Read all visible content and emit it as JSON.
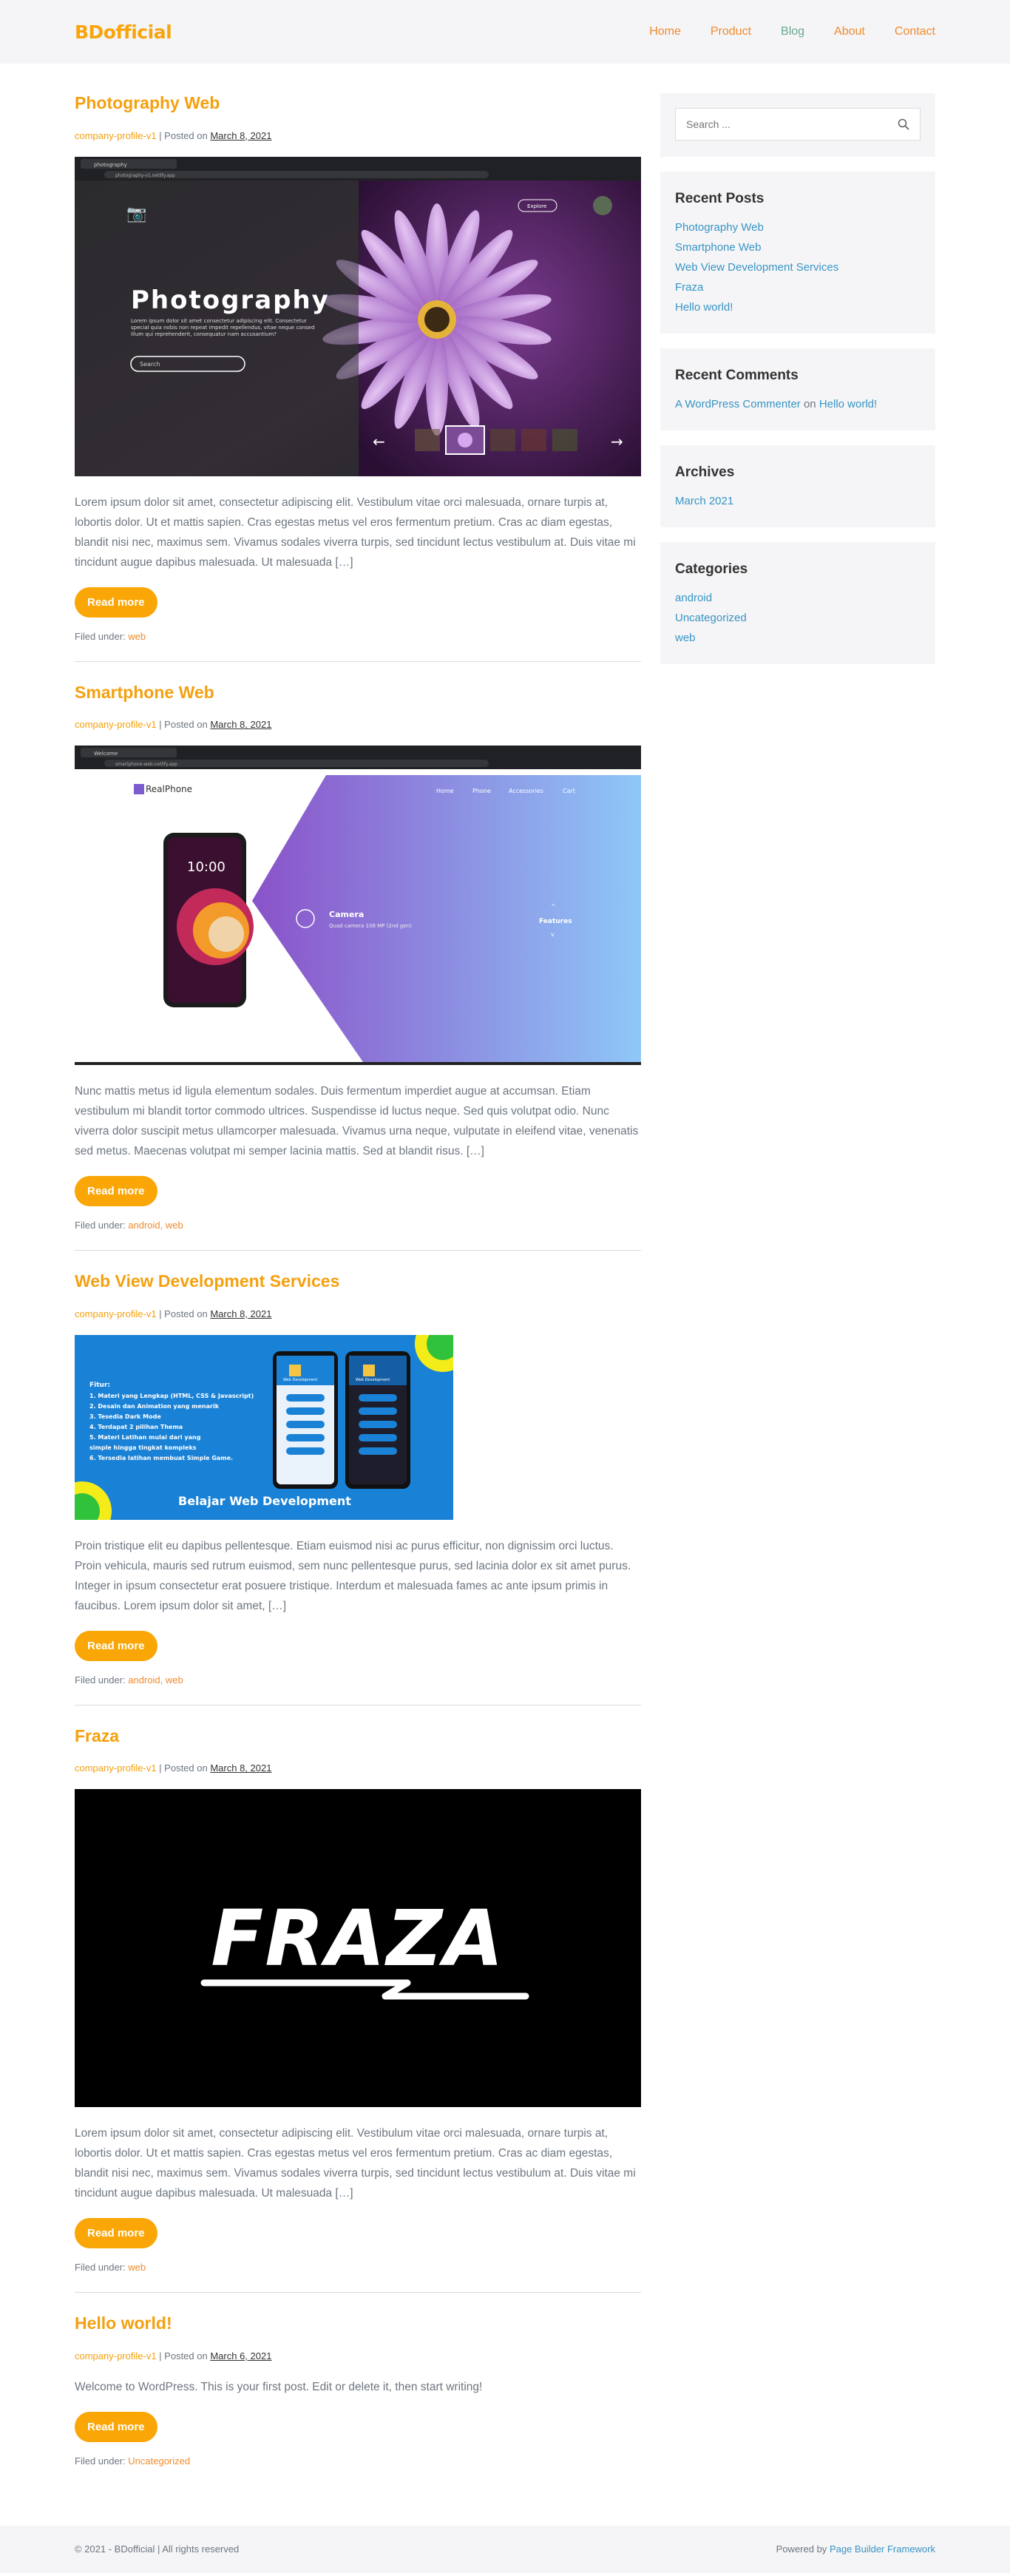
{
  "site": {
    "logo": "BDofficial"
  },
  "nav": [
    {
      "label": "Home"
    },
    {
      "label": "Product"
    },
    {
      "label": "Blog"
    },
    {
      "label": "About"
    },
    {
      "label": "Contact"
    }
  ],
  "posts": [
    {
      "title": "Photography Web",
      "author": "company-profile-v1",
      "posted_on": "Posted on",
      "date": "March 8, 2021",
      "thumb": {
        "tab": "photography",
        "url": "photography-v1.netlify.app",
        "heading": "Photography",
        "text": "Lorem ipsum dolor sit amet consectetur adipiscing elit. Consectetur special quia nobis non repeat impedit repellendus, vitae neque consed illum qui reprehenderit, consequatur nam accusantium?",
        "search": "Search",
        "explore": "Explore"
      },
      "excerpt": "Lorem ipsum dolor sit amet, consectetur adipiscing elit. Vestibulum vitae orci malesuada, ornare turpis at, lobortis dolor. Ut et mattis sapien. Cras egestas metus vel eros fermentum pretium. Cras ac diam egestas, blandit nisi nec, maximus sem. Vivamus sodales viverra turpis, sed tincidunt lectus vestibulum at. Duis vitae mi tincidunt augue dapibus malesuada. Ut malesuada […]",
      "read_more": "Read more",
      "filed_under": "Filed under:",
      "categories": "web"
    },
    {
      "title": "Smartphone Web",
      "author": "company-profile-v1",
      "posted_on": "Posted on",
      "date": "March 8, 2021",
      "thumb": {
        "tab": "Welcome",
        "url": "smartphone-web.netlify.app",
        "brand": "RealPhone",
        "menu": [
          "Home",
          "Phone",
          "Accessories",
          "Cart"
        ],
        "feature_title": "Camera",
        "feature_text": "Quad camera 108 MP (2nd gen)",
        "features_label": "Features",
        "time": "10:00"
      },
      "excerpt": "Nunc mattis metus id ligula elementum sodales. Duis fermentum imperdiet augue at accumsan. Etiam vestibulum mi blandit tortor commodo ultrices. Suspendisse id luctus neque. Sed quis volutpat odio. Nunc viverra dolor suscipit metus ullamcorper malesuada. Vivamus urna neque, vulputate in eleifend vitae, venenatis sed metus. Maecenas volutpat mi semper lacinia mattis. Sed at blandit risus. […]",
      "read_more": "Read more",
      "filed_under": "Filed under:",
      "categories": "android, web"
    },
    {
      "title": "Web View Development Services",
      "author": "company-profile-v1",
      "posted_on": "Posted on",
      "date": "March 8, 2021",
      "thumb": {
        "fitur": "Fitur:",
        "list": [
          "1. Materi yang Lengkap (HTML, CSS & Javascript)",
          "2. Desain dan Animation yang menarik",
          "3. Tesedia Dark Mode",
          "4. Terdapat 2 pilihan Thema",
          "5. Materi Latihan mulai dari yang",
          "    simple hingga tingkat kompleks",
          "6. Tersedia latihan membuat Simple Game."
        ],
        "banner": "Belajar Web Development",
        "phone_title": "Web Development"
      },
      "excerpt": "Proin tristique elit eu dapibus pellentesque. Etiam euismod nisi ac purus efficitur, non dignissim orci luctus. Proin vehicula, mauris sed rutrum euismod, sem nunc pellentesque purus, sed lacinia dolor ex sit amet purus. Integer in ipsum consectetur erat posuere tristique. Interdum et malesuada fames ac ante ipsum primis in faucibus. Lorem ipsum dolor sit amet, […]",
      "read_more": "Read more",
      "filed_under": "Filed under:",
      "categories": "android, web"
    },
    {
      "title": "Fraza",
      "author": "company-profile-v1",
      "posted_on": "Posted on",
      "date": "March 8, 2021",
      "thumb": {
        "wordmark": "FRAZA"
      },
      "excerpt": "Lorem ipsum dolor sit amet, consectetur adipiscing elit. Vestibulum vitae orci malesuada, ornare turpis at, lobortis dolor. Ut et mattis sapien. Cras egestas metus vel eros fermentum pretium. Cras ac diam egestas, blandit nisi nec, maximus sem. Vivamus sodales viverra turpis, sed tincidunt lectus vestibulum at. Duis vitae mi tincidunt augue dapibus malesuada. Ut malesuada […]",
      "read_more": "Read more",
      "filed_under": "Filed under:",
      "categories": "web"
    },
    {
      "title": "Hello world!",
      "author": "company-profile-v1",
      "posted_on": "Posted on",
      "date": "March 6, 2021",
      "excerpt": "Welcome to WordPress. This is your first post. Edit or delete it, then start writing!",
      "read_more": "Read more",
      "filed_under": "Filed under:",
      "categories": "Uncategorized"
    }
  ],
  "sidebar": {
    "search_placeholder": "Search ...",
    "recent_posts_title": "Recent Posts",
    "recent_posts": [
      "Photography Web",
      "Smartphone Web",
      "Web View Development Services",
      "Fraza",
      "Hello world!"
    ],
    "recent_comments_title": "Recent Comments",
    "comment_author": "A WordPress Commenter",
    "comment_on": "on",
    "comment_post": "Hello world!",
    "archives_title": "Archives",
    "archives": [
      "March 2021"
    ],
    "categories_title": "Categories",
    "categories": [
      "android",
      "Uncategorized",
      "web"
    ]
  },
  "footer": {
    "copyright": "© 2021 - BDofficial | All rights reserved",
    "powered_by": "Powered by",
    "framework": "Page Builder Framework"
  },
  "colors": {
    "accent": "#f9a606",
    "link": "#3794c4",
    "background_light": "#f5f5f7"
  }
}
